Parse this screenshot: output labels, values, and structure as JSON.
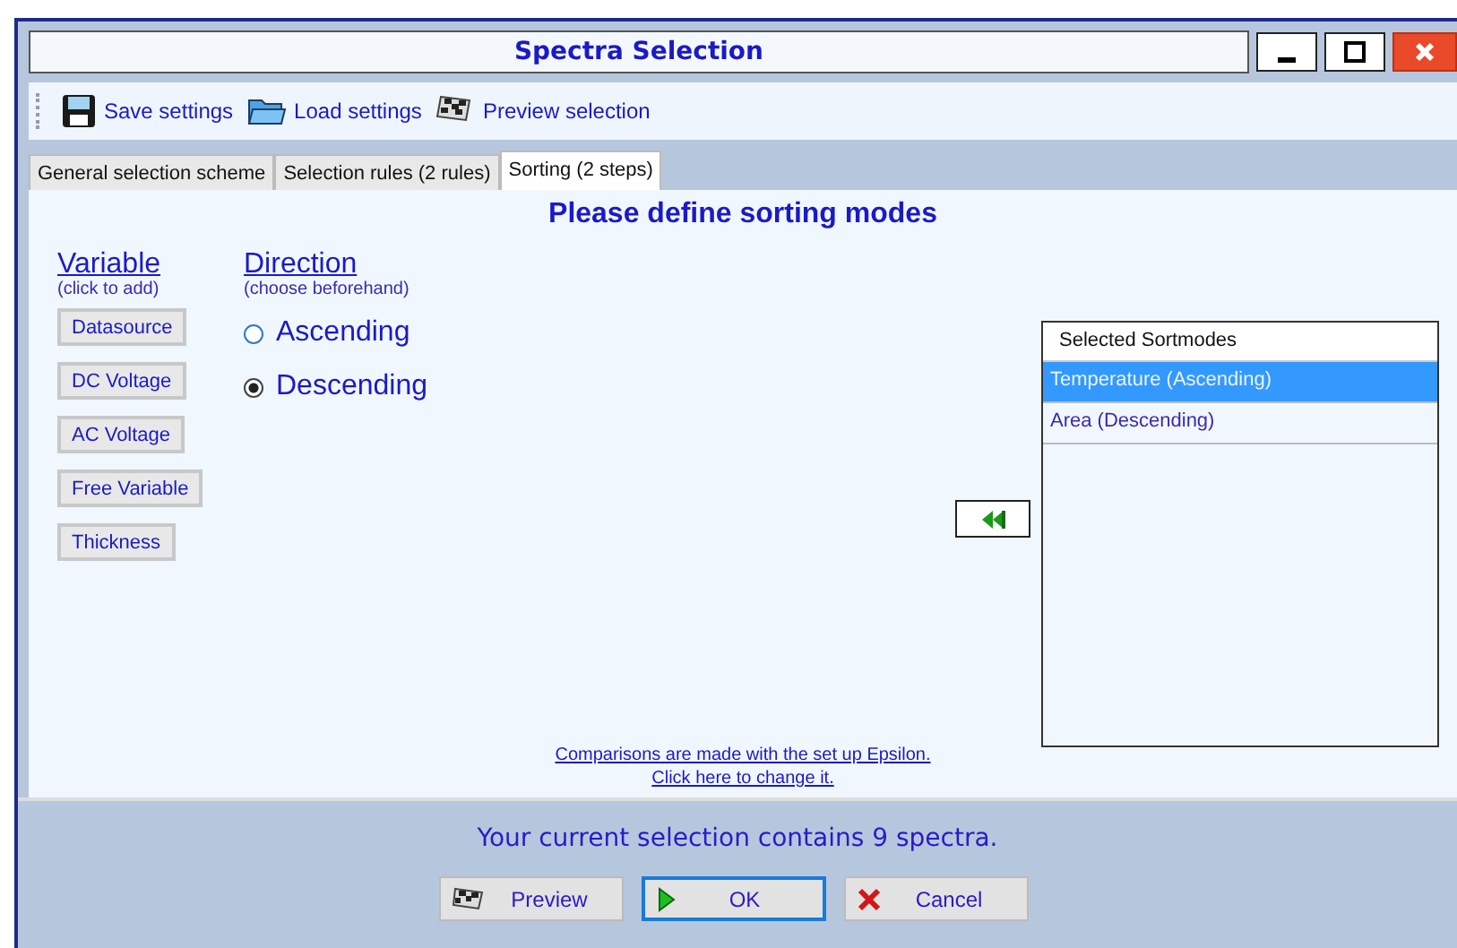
{
  "window": {
    "title": "Spectra Selection"
  },
  "toolbar": [
    {
      "kind": "save",
      "label": "Save settings"
    },
    {
      "kind": "load",
      "label": "Load settings"
    },
    {
      "kind": "preview",
      "label": "Preview selection"
    }
  ],
  "tabs": [
    {
      "label": "General selection scheme",
      "selected": false
    },
    {
      "label": "Selection rules (2 rules)",
      "selected": false
    },
    {
      "label": "Sorting (2 steps)",
      "selected": true
    }
  ],
  "heading": "Please define sorting modes",
  "variable": {
    "title": "Variable",
    "hint": "(click to add)",
    "buttons": [
      "Datasource",
      "DC Voltage",
      "AC Voltage",
      "Free Variable",
      "Thickness"
    ]
  },
  "direction": {
    "title": "Direction",
    "hint": "(choose beforehand)",
    "options": [
      {
        "label": "Ascending",
        "selected": false
      },
      {
        "label": "Descending",
        "selected": true
      }
    ]
  },
  "sortmodes": {
    "header": "Selected Sortmodes",
    "items": [
      {
        "label": "Temperature (Ascending)",
        "selected": true
      },
      {
        "label": "Area (Descending)",
        "selected": false
      }
    ]
  },
  "note_links": [
    "Comparisons are made with the set up Epsilon.",
    "Click here to change it."
  ],
  "status": "Your current selection contains 9 spectra.",
  "buttons": [
    {
      "kind": "preview",
      "label": "Preview",
      "focused": false
    },
    {
      "kind": "ok",
      "label": "OK",
      "focused": true
    },
    {
      "kind": "cancel",
      "label": "Cancel",
      "focused": false
    }
  ]
}
